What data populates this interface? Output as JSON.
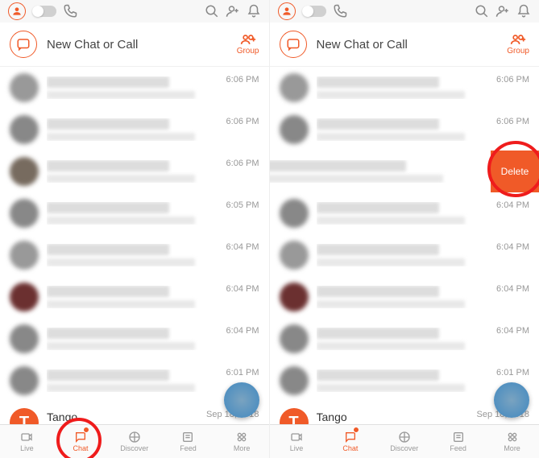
{
  "header": {
    "new_chat_label": "New Chat or Call",
    "group_label": "Group"
  },
  "conversations_left": [
    {
      "time": "6:06 PM",
      "av": "d1"
    },
    {
      "time": "6:06 PM",
      "av": "d4"
    },
    {
      "time": "6:06 PM",
      "av": "d2"
    },
    {
      "time": "6:05 PM",
      "av": "d4"
    },
    {
      "time": "6:04 PM",
      "av": "d1"
    },
    {
      "time": "6:04 PM",
      "av": "d3"
    },
    {
      "time": "6:04 PM",
      "av": "d4"
    },
    {
      "time": "6:01 PM",
      "av": "d4"
    }
  ],
  "conversations_right": [
    {
      "time": "6:06 PM",
      "av": "d1"
    },
    {
      "time": "6:06 PM",
      "av": "d4"
    },
    {
      "time": "",
      "av": "",
      "swiped": true
    },
    {
      "time": "6:04 PM",
      "av": "d4"
    },
    {
      "time": "6:04 PM",
      "av": "d1"
    },
    {
      "time": "6:04 PM",
      "av": "d3"
    },
    {
      "time": "6:04 PM",
      "av": "d4"
    },
    {
      "time": "6:01 PM",
      "av": "d4"
    }
  ],
  "tango_row": {
    "name": "Tango",
    "letter": "T",
    "time": "Sep 18, 2018"
  },
  "delete_label": "Delete",
  "tabs": {
    "live": "Live",
    "chat": "Chat",
    "discover": "Discover",
    "feed": "Feed",
    "more": "More"
  }
}
